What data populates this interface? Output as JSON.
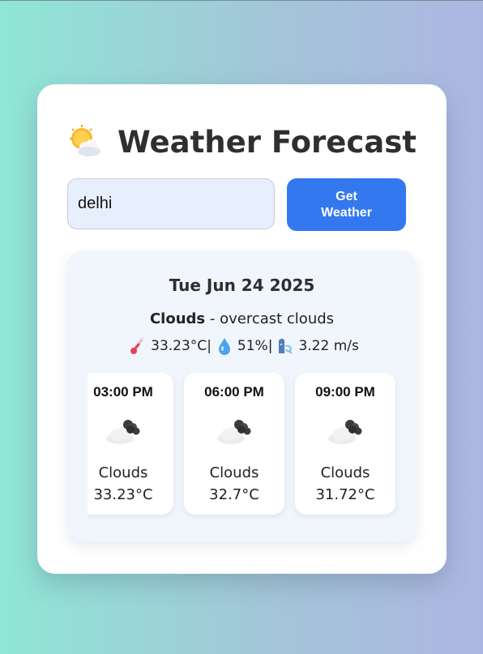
{
  "header": {
    "icon": "sun-behind-cloud-icon",
    "title": "Weather Forecast"
  },
  "search": {
    "value": "delhi",
    "button_label": "Get Weather"
  },
  "current": {
    "date": "Tue Jun 24 2025",
    "condition": "Clouds",
    "separator": " - ",
    "description": "overcast clouds",
    "temperature": "33.23°C",
    "humidity": "51%",
    "wind": "3.22 m/s",
    "sep": " | ",
    "icons": [
      "thermometer-icon",
      "droplet-icon",
      "wind-face-icon"
    ]
  },
  "forecast": [
    {
      "time": "03:00 PM",
      "icon": "cloud-icon",
      "desc": "Clouds",
      "temp": "33.23°C"
    },
    {
      "time": "06:00 PM",
      "icon": "cloud-icon",
      "desc": "Clouds",
      "temp": "32.7°C"
    },
    {
      "time": "09:00 PM",
      "icon": "cloud-icon",
      "desc": "Clouds",
      "temp": "31.72°C"
    }
  ],
  "colors": {
    "accent": "#3478f0",
    "card_bg": "#ffffff",
    "panel_bg": "#f1f5fc",
    "input_bg": "#e8effc"
  }
}
